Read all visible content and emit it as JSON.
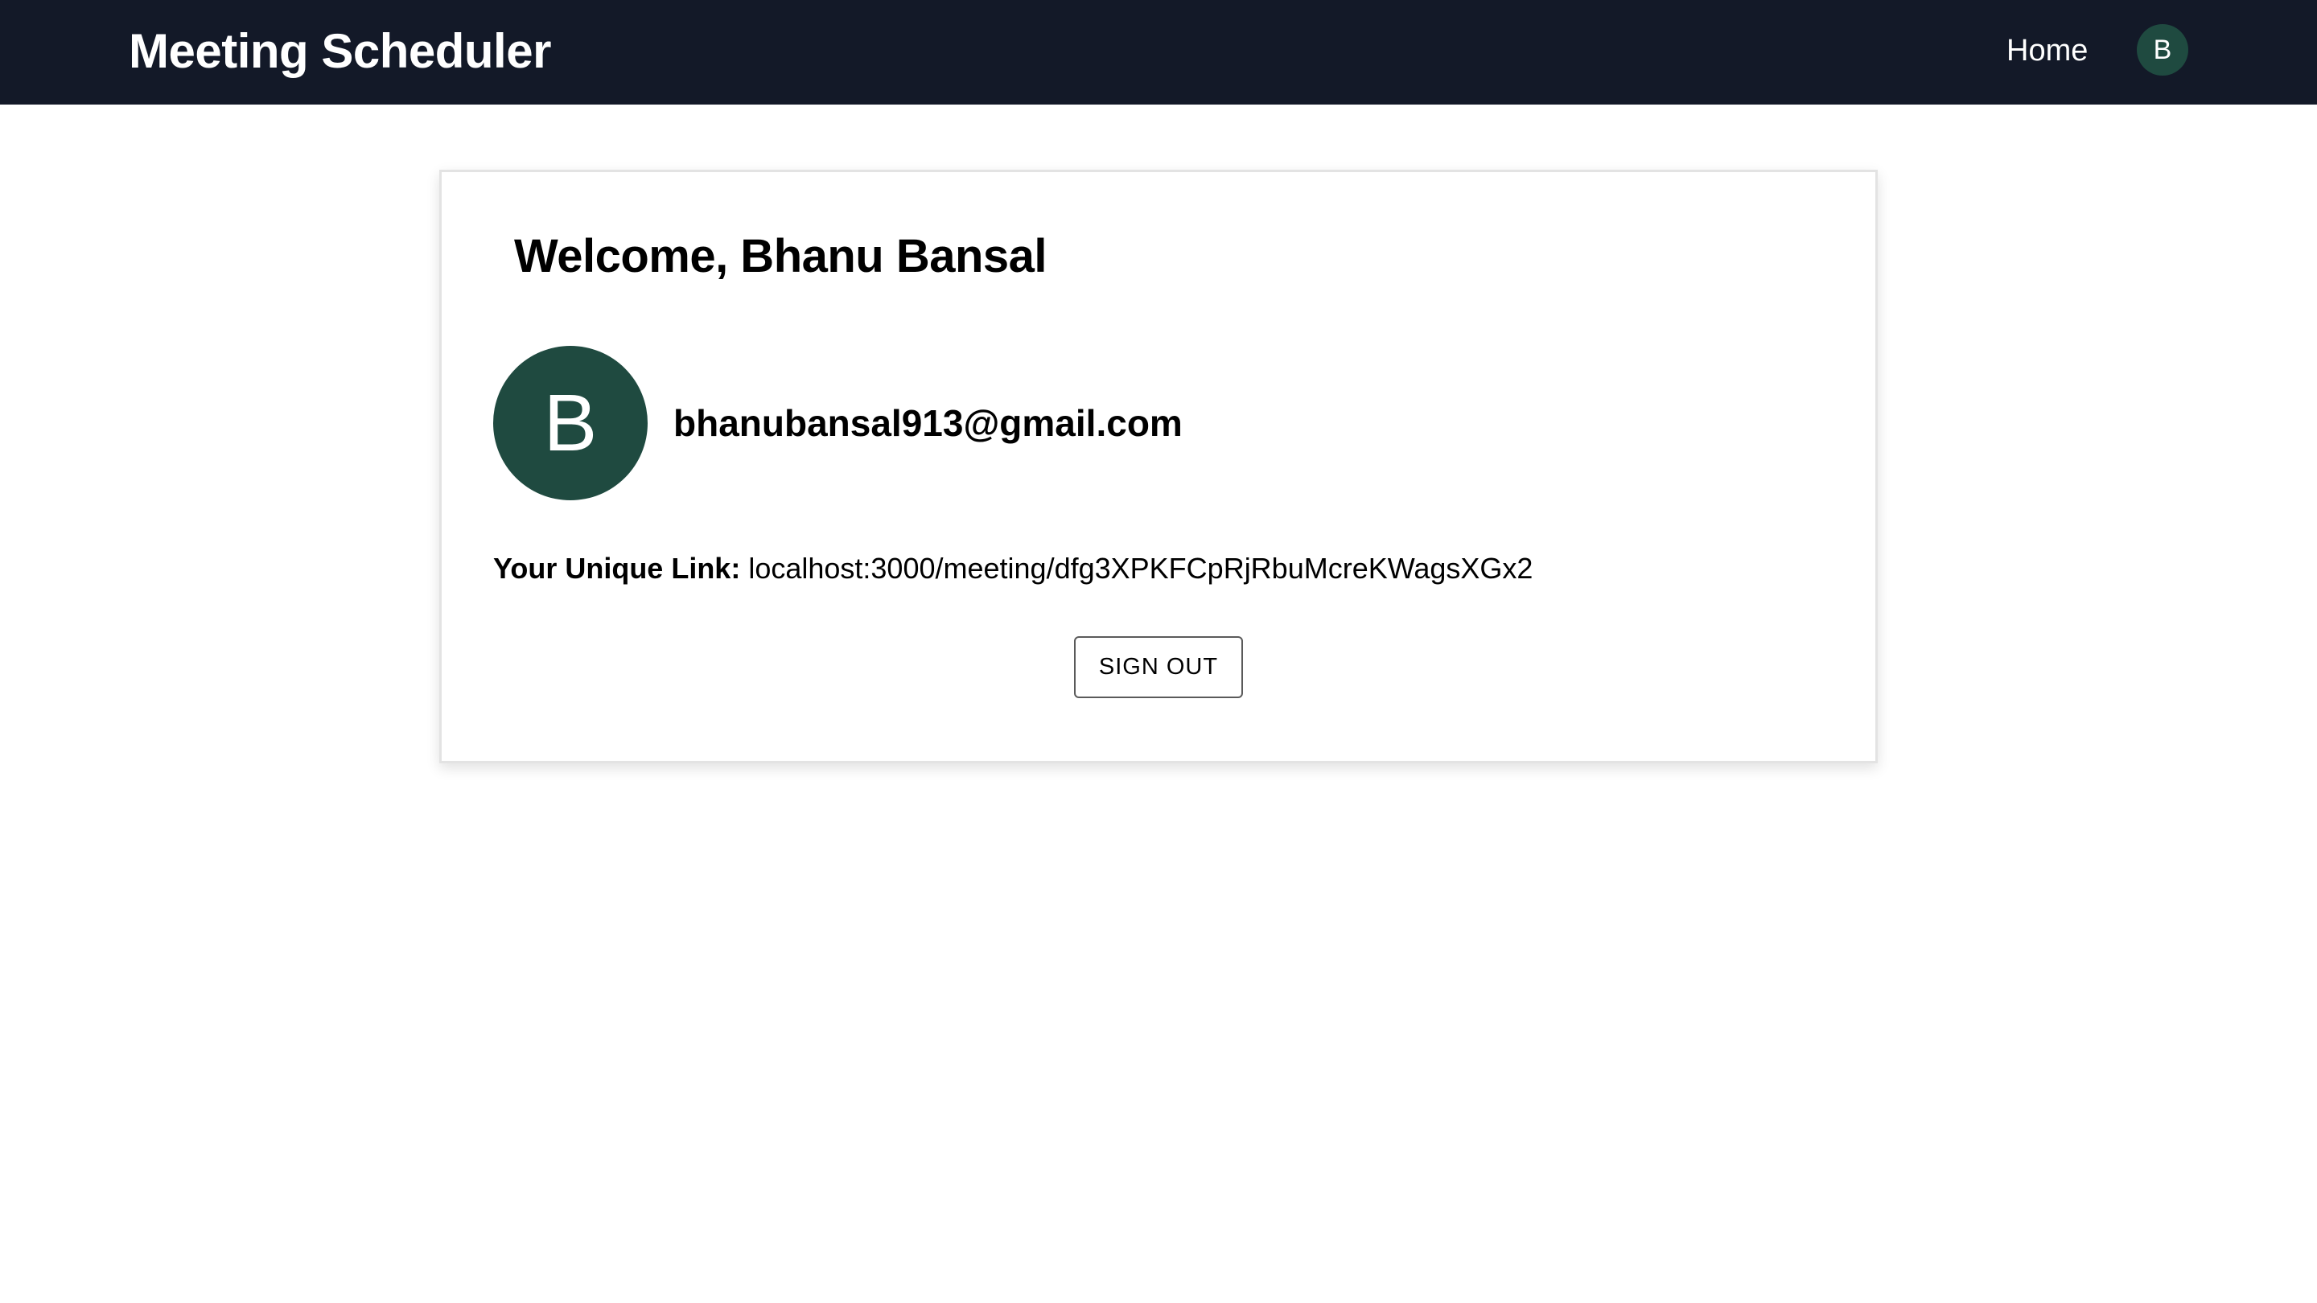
{
  "header": {
    "title": "Meeting Scheduler",
    "nav_home_label": "Home",
    "avatar_initial": "B"
  },
  "profile": {
    "welcome_text": "Welcome, Bhanu Bansal",
    "avatar_initial": "B",
    "email": "bhanubansal913@gmail.com",
    "unique_link_label": "Your Unique Link:",
    "unique_link_value": "localhost:3000/meeting/dfg3XPKFCpRjRbuMcreKWagsXGx2",
    "sign_out_label": "SIGN OUT"
  },
  "colors": {
    "navbar_bg": "#131928",
    "avatar_bg": "#1f4a40"
  }
}
